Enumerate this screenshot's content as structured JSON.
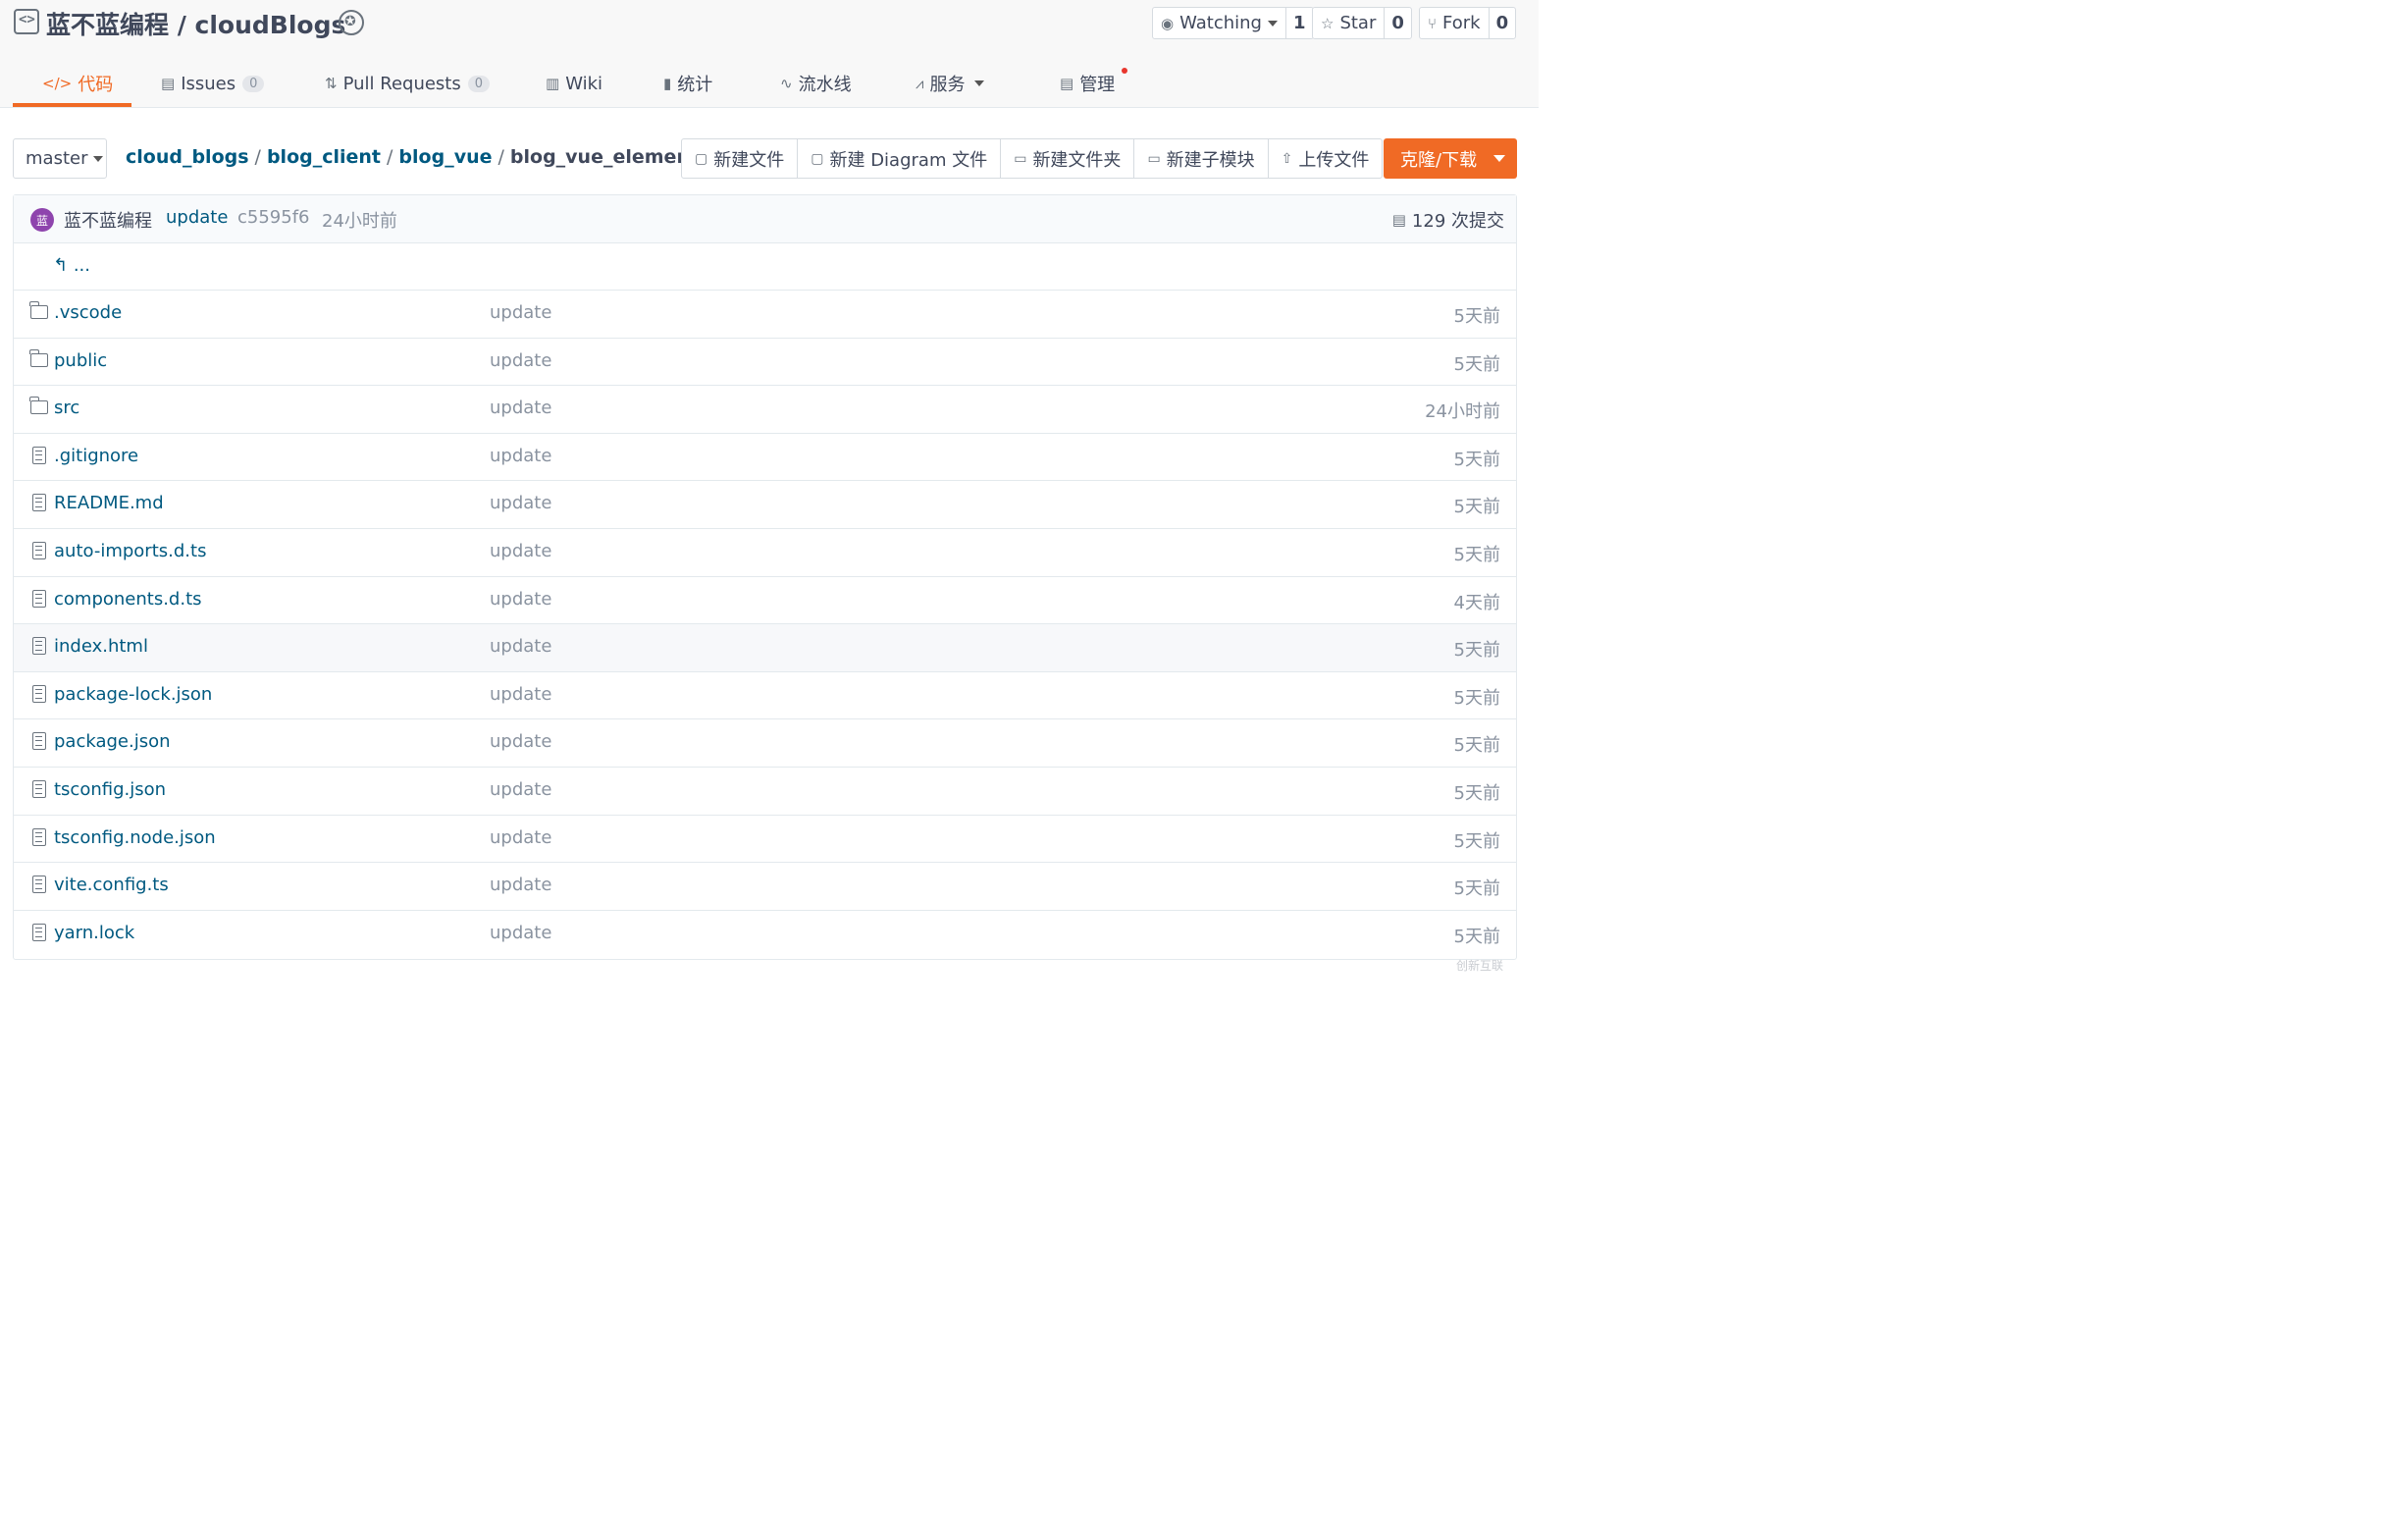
{
  "repo": {
    "title": "蓝不蓝编程 / cloudBlogs",
    "repo_icon": "code-bracket-icon",
    "badge_icon": "award-badge-icon"
  },
  "actions": {
    "watch": {
      "label": "Watching",
      "count": "1"
    },
    "star": {
      "label": "Star",
      "count": "0"
    },
    "fork": {
      "label": "Fork",
      "count": "0"
    }
  },
  "tabs": [
    {
      "label": "代码",
      "icon": "code-icon",
      "active": true
    },
    {
      "label": "Issues",
      "icon": "issues-icon",
      "count": "0"
    },
    {
      "label": "Pull Requests",
      "icon": "pull-request-icon",
      "count": "0"
    },
    {
      "label": "Wiki",
      "icon": "book-icon"
    },
    {
      "label": "统计",
      "icon": "bar-chart-icon"
    },
    {
      "label": "流水线",
      "icon": "pipeline-icon"
    },
    {
      "label": "服务",
      "icon": "pulse-icon"
    },
    {
      "label": "管理",
      "icon": "settings-doc-icon"
    }
  ],
  "branch": {
    "label": "master"
  },
  "breadcrumbs": {
    "items": [
      "cloud_blogs",
      "blog_client",
      "blog_vue"
    ],
    "separator": "/",
    "current": "blog_vue_element-plus"
  },
  "toolbar": {
    "new_file": "新建文件",
    "new_diagram": "新建 Diagram 文件",
    "new_folder": "新建文件夹",
    "new_submodule": "新建子模块",
    "upload": "上传文件",
    "clone": "克隆/下载"
  },
  "commit": {
    "avatar_text": "蓝",
    "author": "蓝不蓝编程",
    "message": "update",
    "sha": "c5595f6",
    "time": "24小时前",
    "count_label": "129 次提交"
  },
  "parent_link": "...",
  "files": [
    {
      "name": ".vscode",
      "type": "folder",
      "message": "update",
      "time": "5天前"
    },
    {
      "name": "public",
      "type": "folder",
      "message": "update",
      "time": "5天前"
    },
    {
      "name": "src",
      "type": "folder",
      "message": "update",
      "time": "24小时前"
    },
    {
      "name": ".gitignore",
      "type": "file",
      "message": "update",
      "time": "5天前"
    },
    {
      "name": "README.md",
      "type": "file",
      "message": "update",
      "time": "5天前"
    },
    {
      "name": "auto-imports.d.ts",
      "type": "file",
      "message": "update",
      "time": "5天前"
    },
    {
      "name": "components.d.ts",
      "type": "file",
      "message": "update",
      "time": "4天前"
    },
    {
      "name": "index.html",
      "type": "file",
      "message": "update",
      "time": "5天前",
      "highlighted": true
    },
    {
      "name": "package-lock.json",
      "type": "file",
      "message": "update",
      "time": "5天前"
    },
    {
      "name": "package.json",
      "type": "file",
      "message": "update",
      "time": "5天前"
    },
    {
      "name": "tsconfig.json",
      "type": "file",
      "message": "update",
      "time": "5天前"
    },
    {
      "name": "tsconfig.node.json",
      "type": "file",
      "message": "update",
      "time": "5天前"
    },
    {
      "name": "vite.config.ts",
      "type": "file",
      "message": "update",
      "time": "5天前"
    },
    {
      "name": "yarn.lock",
      "type": "file",
      "message": "update",
      "time": "5天前"
    }
  ],
  "watermark": "创新互联",
  "colors": {
    "accent": "#f06a25",
    "link": "#005980",
    "muted": "#8a93a0"
  }
}
